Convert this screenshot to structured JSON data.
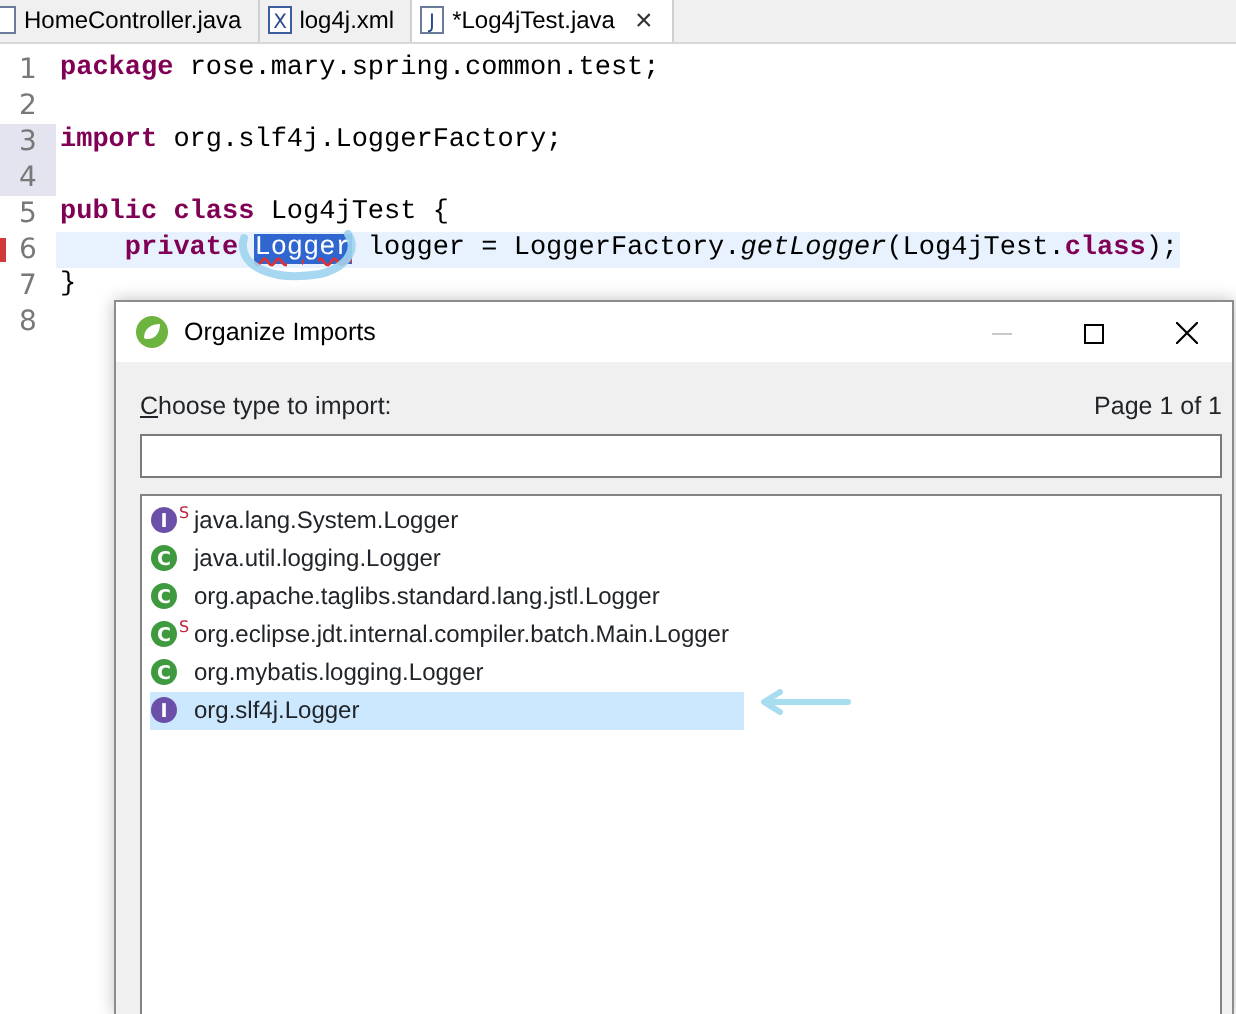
{
  "tabs": [
    {
      "label": "HomeController.java",
      "kind": "java",
      "selected": false
    },
    {
      "label": "log4j.xml",
      "kind": "xml",
      "icon_letter": "X",
      "selected": false
    },
    {
      "label": "*Log4jTest.java",
      "kind": "java",
      "icon_letter": "J",
      "selected": true,
      "close": "×"
    }
  ],
  "editor": {
    "lines": [
      {
        "number": "1",
        "tokens": [
          {
            "text": "package",
            "kind": "keyword"
          },
          {
            "text": " rose.mary.spring.common.test;",
            "kind": "plain"
          }
        ]
      },
      {
        "number": "2"
      },
      {
        "number": "3",
        "marked": true,
        "tokens": [
          {
            "text": "import",
            "kind": "keyword"
          },
          {
            "text": " org.slf4j.LoggerFactory;",
            "kind": "plain"
          }
        ]
      },
      {
        "number": "4",
        "marked": true
      },
      {
        "number": "5",
        "tokens": [
          {
            "text": "public class",
            "kind": "keyword"
          },
          {
            "text": " Log4jTest {",
            "kind": "plain"
          }
        ]
      },
      {
        "number": "6",
        "current": true,
        "error": true,
        "tokens": [
          {
            "text": "    private ",
            "kind": "keyword"
          },
          {
            "text": "Logger",
            "kind": "selected"
          },
          {
            "text": " logger = LoggerFactory.",
            "kind": "plain"
          },
          {
            "text": "getLogger",
            "kind": "italic"
          },
          {
            "text": "(Log4jTest.",
            "kind": "plain"
          },
          {
            "text": "class",
            "kind": "keyword"
          },
          {
            "text": ");",
            "kind": "plain"
          }
        ]
      },
      {
        "number": "7",
        "tokens": [
          {
            "text": "}",
            "kind": "plain"
          }
        ]
      },
      {
        "number": "8"
      }
    ]
  },
  "dialog": {
    "title": "Organize Imports",
    "minimize_disabled": true,
    "label": "Choose type to import:",
    "mnemonic_underlined": true,
    "page": "Page 1 of 1",
    "items": [
      {
        "kind": "interface",
        "letter": "I",
        "modifier": "S",
        "text": "java.lang.System.Logger",
        "selected": false
      },
      {
        "kind": "class",
        "letter": "C",
        "text": "java.util.logging.Logger",
        "selected": false
      },
      {
        "kind": "class",
        "letter": "C",
        "text": "org.apache.taglibs.standard.lang.jstl.Logger",
        "selected": false
      },
      {
        "kind": "class",
        "letter": "C",
        "modifier": "S",
        "text": "org.eclipse.jdt.internal.compiler.batch.Main.Logger",
        "selected": false
      },
      {
        "kind": "class",
        "letter": "C",
        "text": "org.mybatis.logging.Logger",
        "selected": false
      },
      {
        "kind": "interface",
        "letter": "I",
        "text": "org.slf4j.Logger",
        "selected": true
      }
    ]
  }
}
